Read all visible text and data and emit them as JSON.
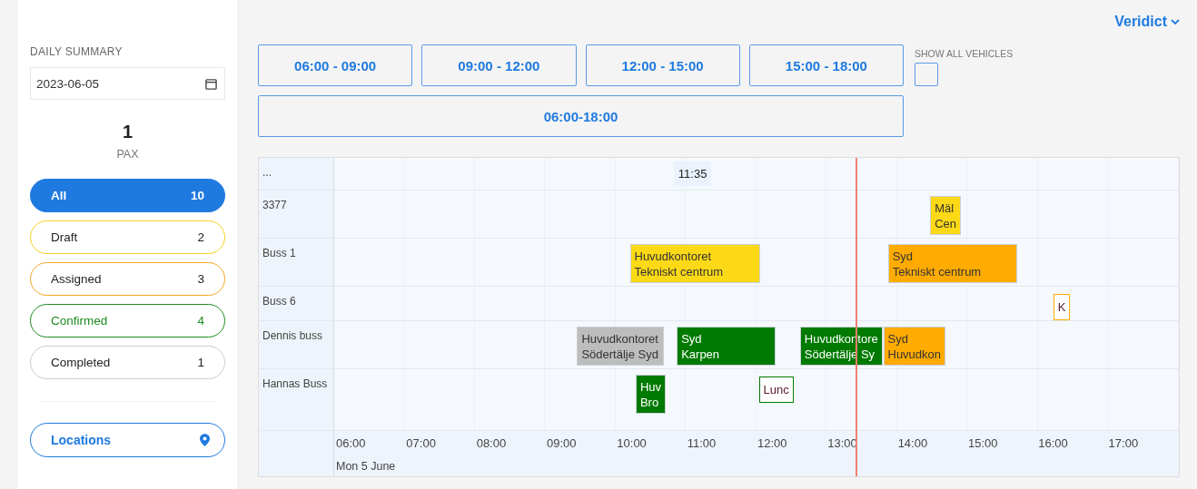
{
  "account": {
    "label": "Veridict"
  },
  "summary": {
    "title": "DAILY SUMMARY",
    "date": "2023-06-05",
    "pax_count": "1",
    "pax_label": "PAX"
  },
  "filters": [
    {
      "label": "All",
      "count": "10",
      "color": "#1f7ae0",
      "selected": true
    },
    {
      "label": "Draft",
      "count": "2",
      "color": "#f5d020",
      "selected": false
    },
    {
      "label": "Assigned",
      "count": "3",
      "color": "#f5a623",
      "selected": false
    },
    {
      "label": "Confirmed",
      "count": "4",
      "color": "#1e8a1e",
      "selected": false
    },
    {
      "label": "Completed",
      "count": "1",
      "color": "#cccccc",
      "selected": false
    }
  ],
  "locations_button": {
    "label": "Locations"
  },
  "time_ranges": [
    {
      "label": "06:00 - 09:00",
      "selected": false
    },
    {
      "label": "09:00 - 12:00",
      "selected": false
    },
    {
      "label": "12:00 - 15:00",
      "selected": false
    },
    {
      "label": "15:00 - 18:00",
      "selected": false
    },
    {
      "label": "06:00-18:00",
      "selected": false
    }
  ],
  "show_all_vehicles": {
    "label": "SHOW ALL VEHICLES",
    "checked": false
  },
  "timeline": {
    "header_label": "...",
    "header_badge": "11:35",
    "rows": [
      {
        "vehicle": "3377",
        "events": [
          {
            "kind": "trip",
            "color": "#fcd916",
            "lines": [
              "Mäl",
              "Cen"
            ]
          }
        ]
      },
      {
        "vehicle": "Buss 1",
        "events": [
          {
            "kind": "trip",
            "color": "#fcd916",
            "lines": [
              "Huvudkontoret",
              "Tekniskt centrum"
            ]
          },
          {
            "kind": "trip",
            "color": "#ffab00",
            "lines": [
              "Syd",
              "Tekniskt centrum"
            ]
          }
        ]
      },
      {
        "vehicle": "Buss 6",
        "events": [
          {
            "kind": "break",
            "color": "#ffab00",
            "lines": [
              "K"
            ]
          }
        ]
      },
      {
        "vehicle": "Dennis buss",
        "events": [
          {
            "kind": "trip",
            "color": "#bdbdbd",
            "lines": [
              "Huvudkontoret",
              "Södertälje Syd"
            ]
          },
          {
            "kind": "trip",
            "color": "#007a00",
            "lines": [
              "Syd",
              "Karpen"
            ]
          },
          {
            "kind": "trip",
            "color": "#007a00",
            "lines": [
              "Huvudkontore",
              "Södertälje Sy"
            ]
          },
          {
            "kind": "trip",
            "color": "#ffab00",
            "lines": [
              "Syd",
              "Huvudkon"
            ]
          }
        ]
      },
      {
        "vehicle": "Hannas Buss",
        "events": [
          {
            "kind": "trip",
            "color": "#007a00",
            "lines": [
              "Huv",
              "Bro"
            ]
          },
          {
            "kind": "break",
            "color": "#007a00",
            "lines": [
              "Lunc"
            ]
          }
        ]
      }
    ],
    "hours": [
      "06:00",
      "07:00",
      "08:00",
      "09:00",
      "10:00",
      "11:00",
      "12:00",
      "13:00",
      "14:00",
      "15:00",
      "16:00",
      "17:00"
    ],
    "date_label": "Mon 5 June"
  }
}
